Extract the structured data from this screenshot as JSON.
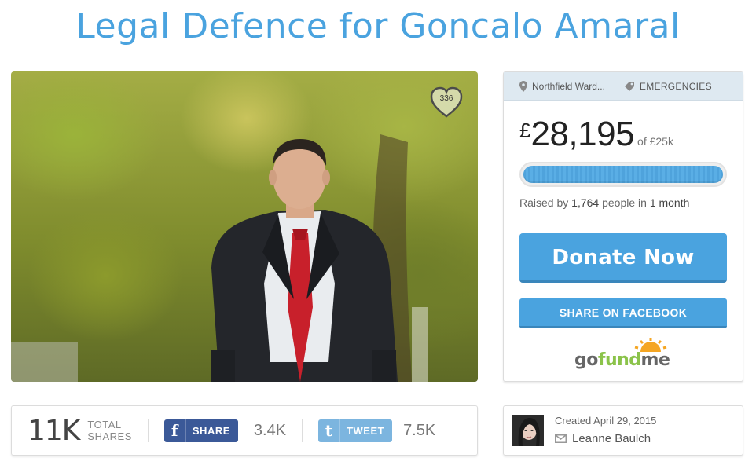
{
  "title": "Legal Defence for Goncalo Amaral",
  "hero": {
    "heart_count": "336"
  },
  "card": {
    "location": "Northfield Ward...",
    "category": "EMERGENCIES",
    "currency": "£",
    "amount": "28,195",
    "goal": "of £25k",
    "progress": 1.0,
    "raised_prefix": "Raised by ",
    "people": "1,764",
    "raised_mid": " people in ",
    "duration": "1 month",
    "donate_label": "Donate Now",
    "fb_share_label": "SHARE ON FACEBOOK",
    "brand_go": "go",
    "brand_fund": "fund",
    "brand_me": "me"
  },
  "share_bar": {
    "total": "11K",
    "total_label_1": "TOTAL",
    "total_label_2": "SHARES",
    "fb_label": "SHARE",
    "fb_count": "3.4K",
    "tw_label": "TWEET",
    "tw_count": "7.5K"
  },
  "organizer": {
    "created": "Created April 29, 2015",
    "name": "Leanne Baulch"
  },
  "colors": {
    "accent": "#4aa3df",
    "facebook": "#3b5998",
    "twitter": "#7cb5df",
    "brand_green": "#8bc34a"
  }
}
